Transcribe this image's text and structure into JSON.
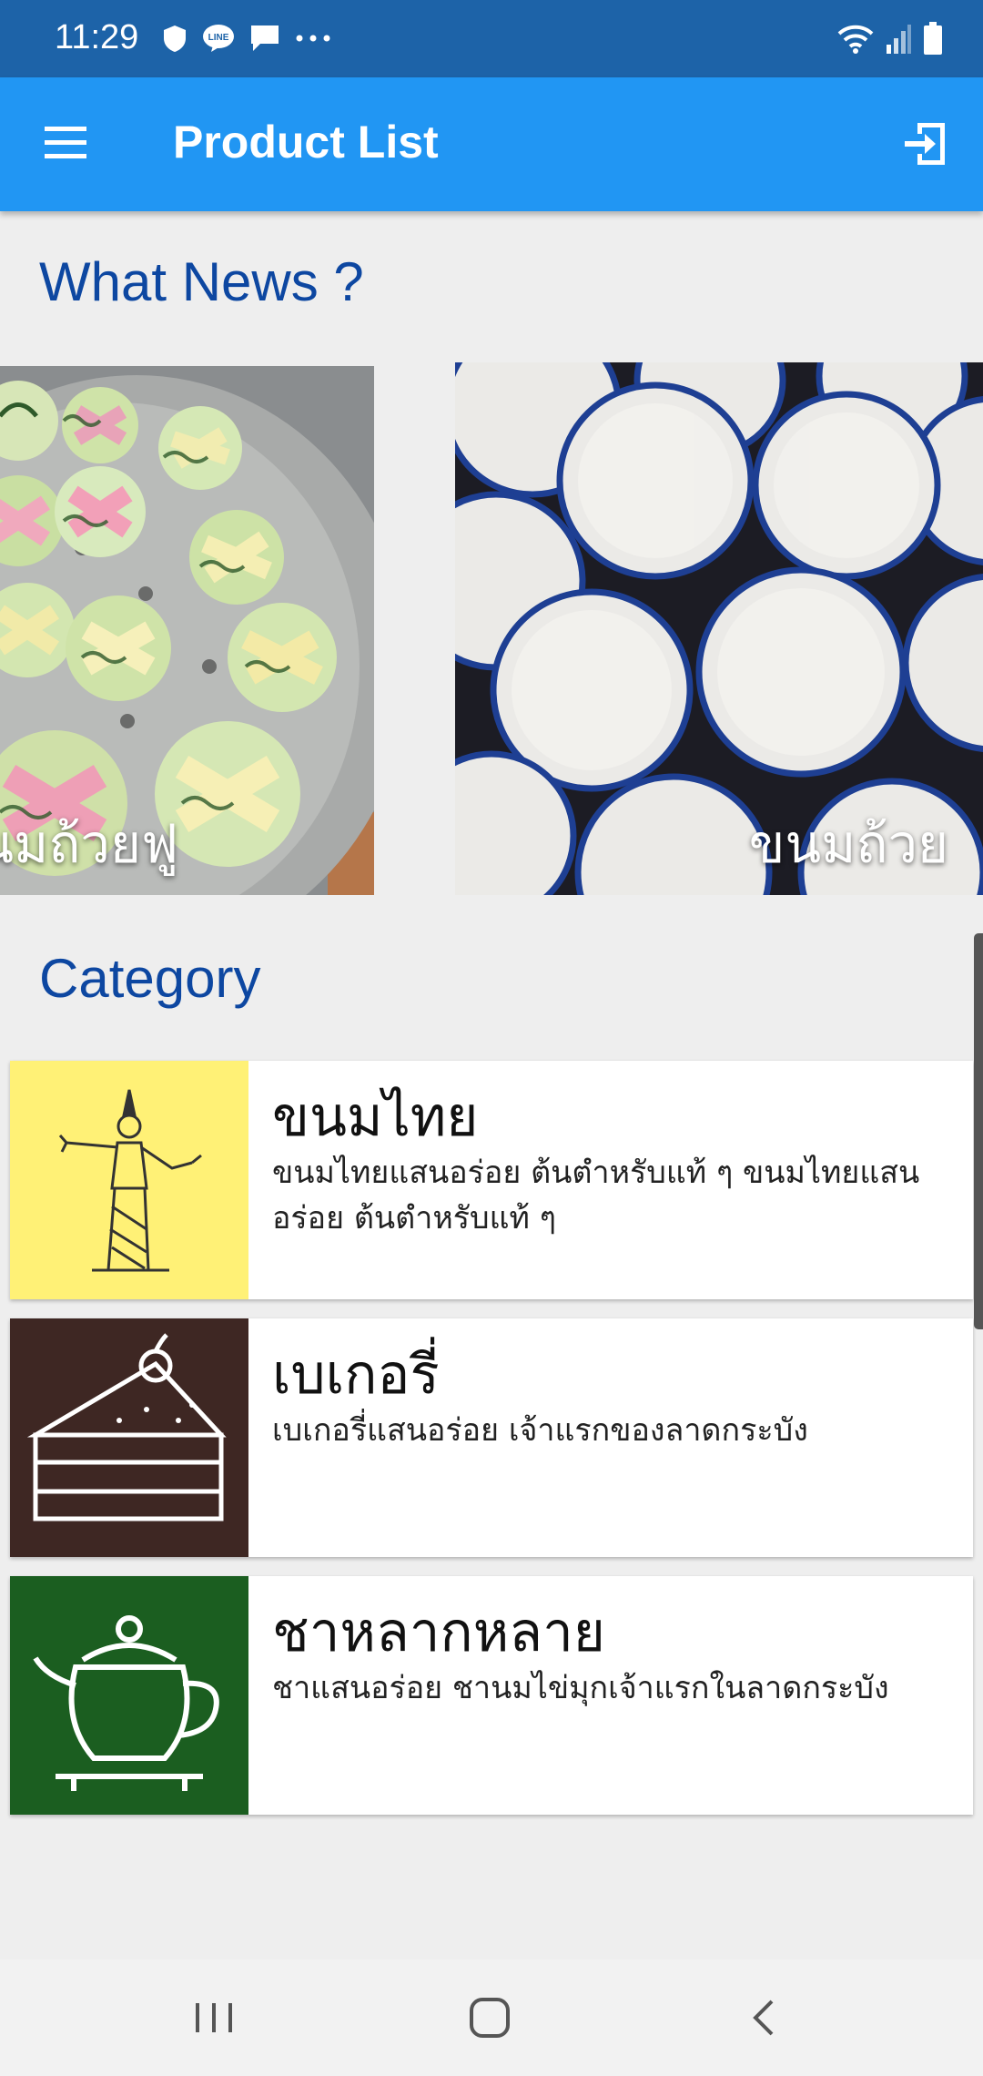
{
  "status_bar": {
    "time": "11:29",
    "left_icons": [
      "shield-icon",
      "line-app-icon",
      "message-icon",
      "more-dots-icon"
    ],
    "right_icons": [
      "wifi-icon",
      "signal-icon",
      "battery-icon"
    ]
  },
  "app_bar": {
    "title": "Product List",
    "menu_icon": "hamburger-menu-icon",
    "logout_icon": "logout-icon",
    "color": "#2196f3"
  },
  "news": {
    "title": "What News ?",
    "items": [
      {
        "caption": "ขนมถ้วยฟู",
        "image": "steamed-cupcakes-photo"
      },
      {
        "caption": "ขนมถ้วย",
        "image": "coconut-cups-photo"
      }
    ]
  },
  "category": {
    "title": "Category",
    "items": [
      {
        "name": "ขนมไทย",
        "description": "ขนมไทยแสนอร่อย ต้นตำหรับแท้ ๆ ขนมไทยแสนอร่อย ต้นตำหรับแท้ ๆ",
        "icon": "thai-dancer-icon",
        "bg": "#fff176"
      },
      {
        "name": "เบเกอรี่",
        "description": "เบเกอรี่แสนอร่อย เจ้าแรกของลาดกระบัง",
        "icon": "cake-slice-icon",
        "bg": "#3e2723"
      },
      {
        "name": "ชาหลากหลาย",
        "description": "ชาแสนอร่อย ชานมไข่มุกเจ้าแรกในลาดกระบัง",
        "icon": "teapot-icon",
        "bg": "#1b5e20"
      }
    ]
  },
  "nav_bar": {
    "buttons": [
      "recent-apps-icon",
      "home-icon",
      "back-icon"
    ]
  }
}
